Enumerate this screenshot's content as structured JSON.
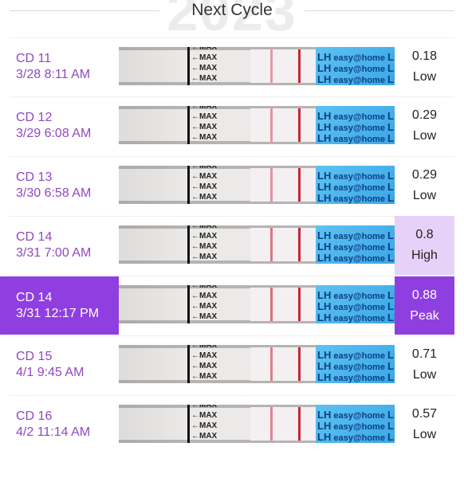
{
  "header": {
    "background_year": "2023",
    "title": "Next Cycle"
  },
  "strip_text": {
    "max_label": "←MAX",
    "brand_text": "easy@home",
    "lh_text": "LH"
  },
  "rows": [
    {
      "cd": "CD 11",
      "datetime": "3/28 8:11 AM",
      "value": "0.18",
      "level": "Low",
      "test_line_intensity": 0.55,
      "selected": false
    },
    {
      "cd": "CD 12",
      "datetime": "3/29 6:08 AM",
      "value": "0.29",
      "level": "Low",
      "test_line_intensity": 0.6,
      "selected": false
    },
    {
      "cd": "CD 13",
      "datetime": "3/30 6:58 AM",
      "value": "0.29",
      "level": "Low",
      "test_line_intensity": 0.6,
      "selected": false
    },
    {
      "cd": "CD 14",
      "datetime": "3/31 7:00 AM",
      "value": "0.8",
      "level": "High",
      "test_line_intensity": 0.8,
      "selected": false
    },
    {
      "cd": "CD 14",
      "datetime": "3/31 12:17 PM",
      "value": "0.88",
      "level": "Peak",
      "test_line_intensity": 0.85,
      "selected": true
    },
    {
      "cd": "CD 15",
      "datetime": "4/1 9:45 AM",
      "value": "0.71",
      "level": "Low",
      "test_line_intensity": 0.75,
      "selected": false
    },
    {
      "cd": "CD 16",
      "datetime": "4/2 11:14 AM",
      "value": "0.57",
      "level": "Low",
      "test_line_intensity": 0.7,
      "selected": false
    }
  ],
  "colors": {
    "accent_purple": "#8f3fe0",
    "label_purple": "#9148c2",
    "high_highlight": "#e6d1f8",
    "control_line": "#c4263a",
    "test_line": "#d8566a",
    "strip_blue": "#4fb7ee"
  }
}
